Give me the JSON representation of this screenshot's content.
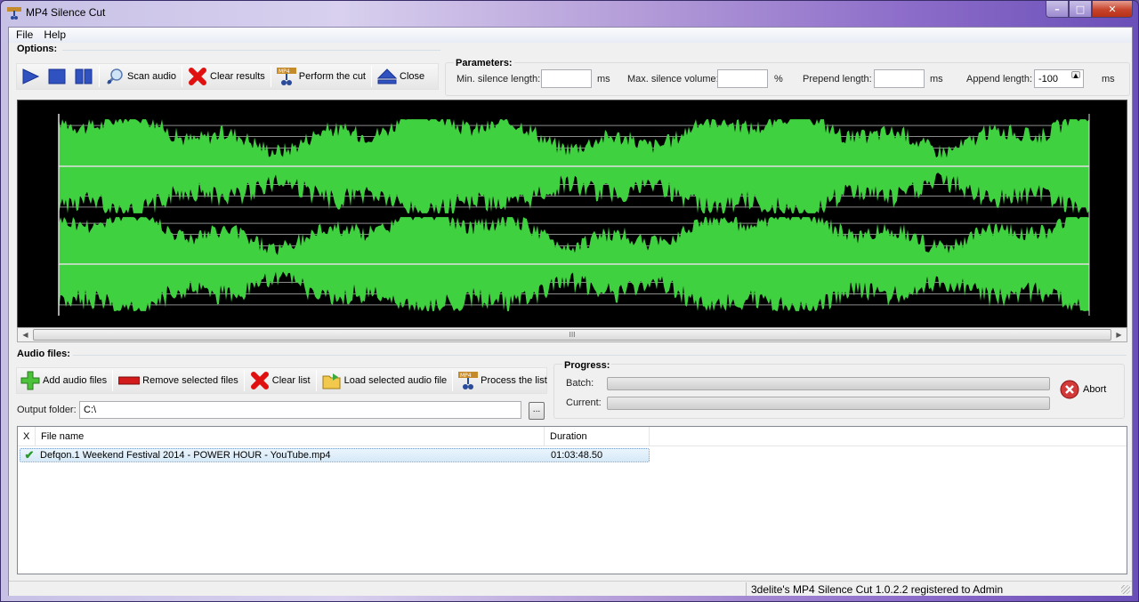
{
  "window": {
    "title": "MP4 Silence Cut",
    "controls": {
      "minimize": "–",
      "maximize": "□",
      "close": "✕"
    }
  },
  "menu": [
    {
      "label": "File"
    },
    {
      "label": "Help"
    }
  ],
  "options": {
    "label": "Options:",
    "toolbar": {
      "play_icon": "play-icon",
      "stop_icon": "stop-icon",
      "pause_icon": "pause-icon",
      "scan_label": "Scan audio",
      "clear_results_label": "Clear results",
      "perform_cut_label": "Perform the cut",
      "close_label": "Close"
    }
  },
  "parameters": {
    "label": "Parameters:",
    "min_silence_length": {
      "label": "Min. silence length:",
      "value": "",
      "unit": "ms"
    },
    "max_silence_volume": {
      "label": "Max. silence volume:",
      "value": "",
      "unit": "%"
    },
    "prepend_length": {
      "label": "Prepend length:",
      "value": "",
      "unit": "ms"
    },
    "append_length": {
      "label": "Append length:",
      "value": "-100",
      "unit": "ms"
    }
  },
  "waveform": {
    "channels": 2,
    "color": "#3fd13f",
    "background": "#000000",
    "grid_color": "#8a8a8a",
    "scroll_thumb_glyph": "III"
  },
  "audio_files": {
    "label": "Audio files:",
    "toolbar": {
      "add_label": "Add audio files",
      "remove_label": "Remove selected files",
      "clear_label": "Clear list",
      "load_label": "Load selected audio file",
      "process_label": "Process the list"
    },
    "output_folder": {
      "label": "Output folder:",
      "value": "C:\\",
      "browse_label": "..."
    }
  },
  "progress": {
    "label": "Progress:",
    "batch": {
      "label": "Batch:",
      "value": 0
    },
    "current": {
      "label": "Current:",
      "value": 0
    },
    "abort_label": "Abort"
  },
  "file_list": {
    "columns": [
      "X",
      "File name",
      "Duration"
    ],
    "rows": [
      {
        "checked": true,
        "name": "Defqon.1 Weekend Festival 2014 - POWER HOUR - YouTube.mp4",
        "duration": "01:03:48.50"
      }
    ]
  },
  "status_bar": {
    "text": "3delite's MP4 Silence Cut 1.0.2.2 registered to Admin"
  }
}
